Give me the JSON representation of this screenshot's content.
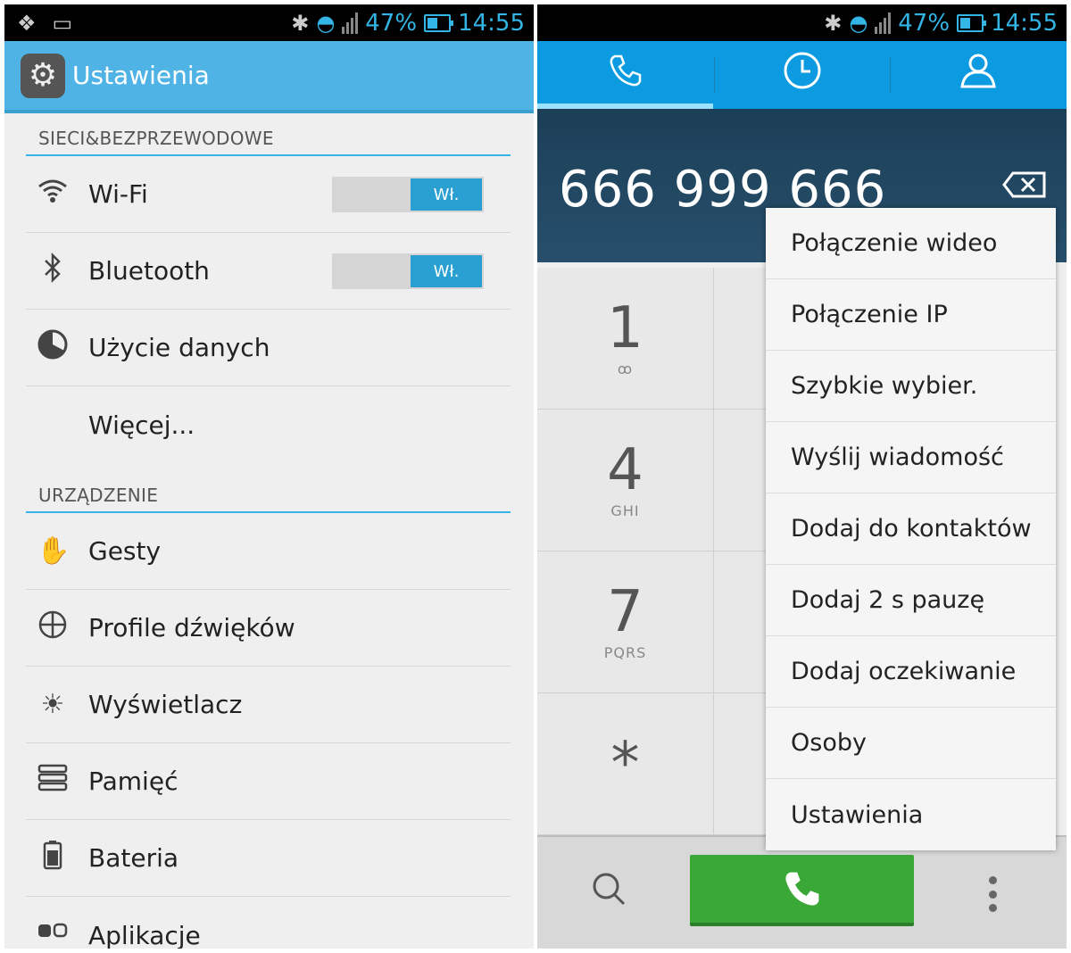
{
  "status": {
    "battery": "47%",
    "time": "14:55"
  },
  "settings": {
    "title": "Ustawienia",
    "section_network": "SIECI&BEZPRZEWODOWE",
    "section_device": "URZĄDZENIE",
    "items": [
      {
        "label": "Wi-Fi",
        "icon": "wifi-icon",
        "toggle": "Wł."
      },
      {
        "label": "Bluetooth",
        "icon": "bluetooth-icon",
        "toggle": "Wł."
      },
      {
        "label": "Użycie danych",
        "icon": "data-usage-icon"
      },
      {
        "label": "Więcej..."
      }
    ],
    "device_items": [
      {
        "label": "Gesty",
        "icon": "hand-icon"
      },
      {
        "label": "Profile dźwięków",
        "icon": "sound-profile-icon"
      },
      {
        "label": "Wyświetlacz",
        "icon": "brightness-icon"
      },
      {
        "label": "Pamięć",
        "icon": "storage-icon"
      },
      {
        "label": "Bateria",
        "icon": "battery-icon"
      },
      {
        "label": "Aplikacje",
        "icon": "apps-icon"
      }
    ]
  },
  "dialer": {
    "number": "666 999 666",
    "keys": [
      {
        "digit": "1",
        "sub": "ꝏ"
      },
      {
        "digit": "4",
        "sub": "GHI"
      },
      {
        "digit": "7",
        "sub": "PQRS"
      },
      {
        "digit": "*",
        "sub": ""
      }
    ],
    "menu": [
      "Połączenie wideo",
      "Połączenie IP",
      "Szybkie wybier.",
      "Wyślij wiadomość",
      "Dodaj do kontaktów",
      "Dodaj 2 s pauzę",
      "Dodaj oczekiwanie",
      "Osoby",
      "Ustawienia"
    ]
  }
}
